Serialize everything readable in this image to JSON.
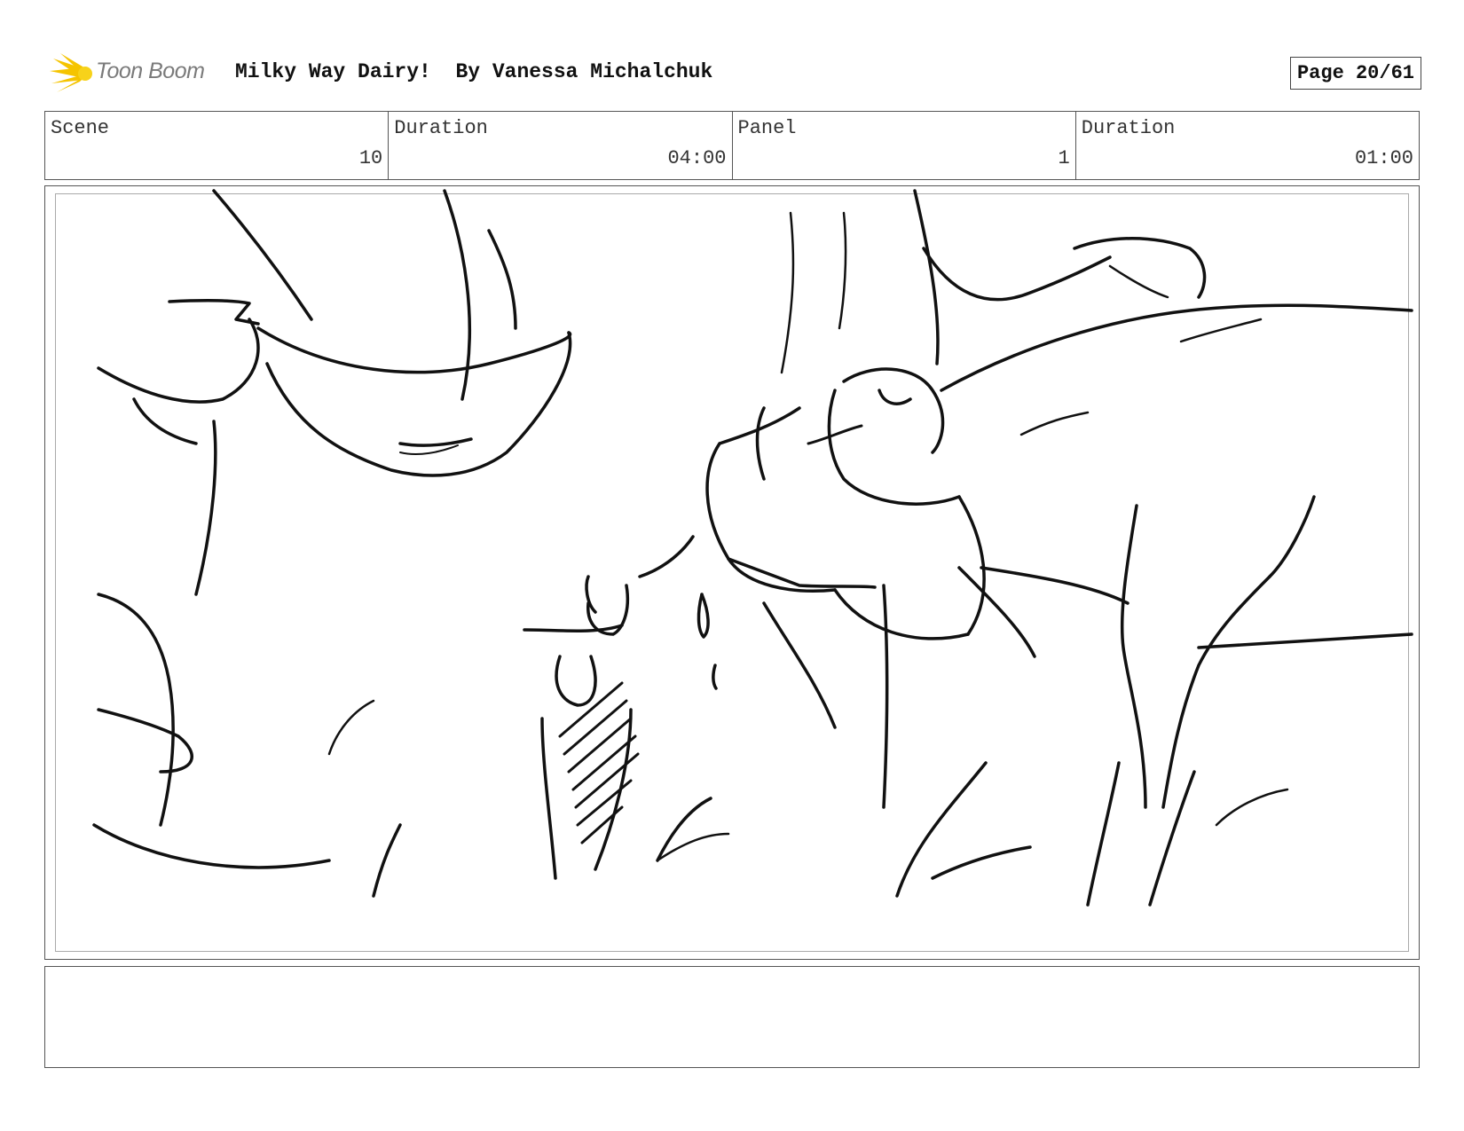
{
  "header": {
    "logo_text": "Toon Boom",
    "title": "Milky Way Dairy!  By Vanessa Michalchuk",
    "page": "Page 20/61"
  },
  "info": {
    "scene_label": "Scene",
    "scene_value": "10",
    "scene_duration_label": "Duration",
    "scene_duration_value": "04:00",
    "panel_label": "Panel",
    "panel_value": "1",
    "panel_duration_label": "Duration",
    "panel_duration_value": "01:00"
  },
  "notes": {
    "text": ""
  }
}
